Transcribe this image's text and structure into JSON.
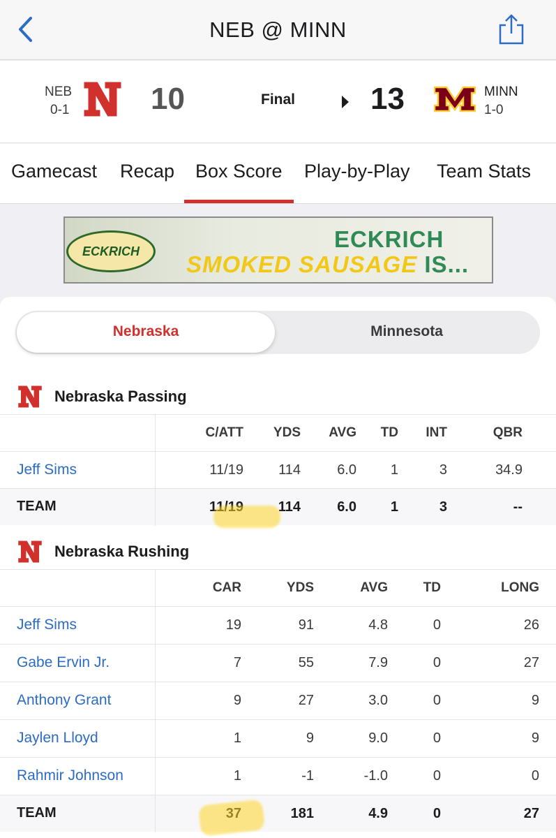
{
  "nav": {
    "title": "NEB @ MINN",
    "back_icon": "chevron-left-icon",
    "share_icon": "share-icon"
  },
  "game": {
    "away": {
      "abbr": "NEB",
      "record": "0-1",
      "score": "10",
      "logo_letter": "N",
      "color": "#d0312d"
    },
    "home": {
      "abbr": "MINN",
      "record": "1-0",
      "score": "13",
      "logo_letter": "M",
      "color": "#7a0019",
      "accent": "#ffcc33"
    },
    "status": "Final"
  },
  "tabs": [
    {
      "label": "Gamecast"
    },
    {
      "label": "Recap"
    },
    {
      "label": "Box Score"
    },
    {
      "label": "Play-by-Play"
    },
    {
      "label": "Team Stats"
    }
  ],
  "active_tab": "Box Score",
  "ad": {
    "brand": "ECKRICH",
    "headline": "ECKRICH",
    "tagline": "SMOKED SAUSAGE",
    "tagline_end": "IS..."
  },
  "team_toggle": {
    "options": [
      "Nebraska",
      "Minnesota"
    ],
    "selected": "Nebraska",
    "selected_color": "#d0312d"
  },
  "passing": {
    "title": "Nebraska Passing",
    "columns": [
      "C/ATT",
      "YDS",
      "AVG",
      "TD",
      "INT",
      "QBR"
    ],
    "rows": [
      {
        "name": "Jeff Sims",
        "values": [
          "11/19",
          "114",
          "6.0",
          "1",
          "3",
          "34.9"
        ]
      }
    ],
    "team": {
      "name": "TEAM",
      "values": [
        "11/19",
        "114",
        "6.0",
        "1",
        "3",
        "--"
      ]
    }
  },
  "rushing": {
    "title": "Nebraska Rushing",
    "columns": [
      "CAR",
      "YDS",
      "AVG",
      "TD",
      "LONG"
    ],
    "rows": [
      {
        "name": "Jeff Sims",
        "values": [
          "19",
          "91",
          "4.8",
          "0",
          "26"
        ]
      },
      {
        "name": "Gabe Ervin Jr.",
        "values": [
          "7",
          "55",
          "7.9",
          "0",
          "27"
        ]
      },
      {
        "name": "Anthony Grant",
        "values": [
          "9",
          "27",
          "3.0",
          "0",
          "9"
        ]
      },
      {
        "name": "Jaylen Lloyd",
        "values": [
          "1",
          "9",
          "9.0",
          "0",
          "9"
        ]
      },
      {
        "name": "Rahmir Johnson",
        "values": [
          "1",
          "-1",
          "-1.0",
          "0",
          "0"
        ]
      }
    ],
    "team": {
      "name": "TEAM",
      "values": [
        "37",
        "181",
        "4.9",
        "0",
        "27"
      ]
    }
  }
}
